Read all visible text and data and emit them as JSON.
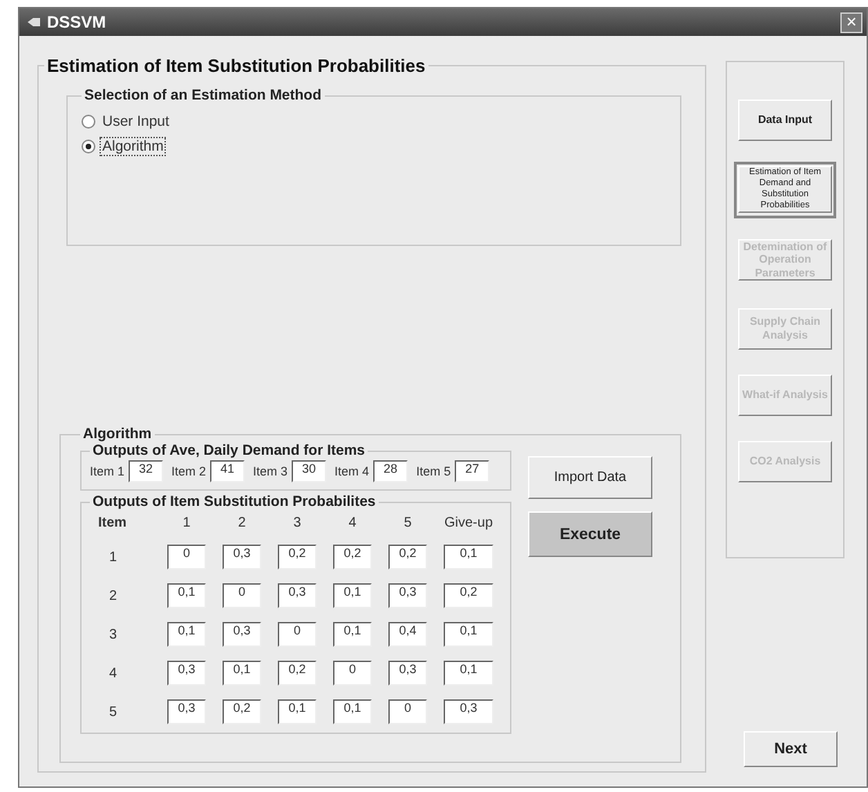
{
  "window": {
    "title": "DSSVM",
    "close": "×"
  },
  "main": {
    "title": "Estimation of Item Substitution Probabilities",
    "method": {
      "title": "Selection of an Estimation Method",
      "options": [
        {
          "label": "User Input",
          "selected": false,
          "focused": false
        },
        {
          "label": "Algorithm",
          "selected": true,
          "focused": true
        }
      ]
    },
    "algorithm": {
      "title": "Algorithm",
      "demand": {
        "title": "Outputs of Ave, Daily Demand for Items",
        "items": [
          {
            "label": "Item 1",
            "value": "32"
          },
          {
            "label": "Item 2",
            "value": "41"
          },
          {
            "label": "Item 3",
            "value": "30"
          },
          {
            "label": "Item 4",
            "value": "28"
          },
          {
            "label": "Item 5",
            "value": "27"
          }
        ]
      },
      "substitution": {
        "title": "Outputs of Item Substitution Probabilites",
        "columns": [
          "Item",
          "1",
          "2",
          "3",
          "4",
          "5",
          "Give-up"
        ],
        "rows": [
          {
            "item": "1",
            "values": [
              "0",
              "0,3",
              "0,2",
              "0,2",
              "0,2",
              "0,1"
            ]
          },
          {
            "item": "2",
            "values": [
              "0,1",
              "0",
              "0,3",
              "0,1",
              "0,3",
              "0,2"
            ]
          },
          {
            "item": "3",
            "values": [
              "0,1",
              "0,3",
              "0",
              "0,1",
              "0,4",
              "0,1"
            ]
          },
          {
            "item": "4",
            "values": [
              "0,3",
              "0,1",
              "0,2",
              "0",
              "0,3",
              "0,1"
            ]
          },
          {
            "item": "5",
            "values": [
              "0,3",
              "0,2",
              "0,1",
              "0,1",
              "0",
              "0,3"
            ]
          }
        ]
      },
      "buttons": [
        {
          "label": "Import Data",
          "pressed": false
        },
        {
          "label": "Execute",
          "pressed": true
        }
      ]
    }
  },
  "nav": {
    "items": [
      {
        "label": "Data Input",
        "selected": false,
        "disabled": false,
        "small": false
      },
      {
        "label": "Estimation of Item Demand and Substitution Probabilities",
        "selected": true,
        "disabled": false,
        "small": true
      },
      {
        "label": "Detemination of Operation Parameters",
        "selected": false,
        "disabled": true,
        "small": false
      },
      {
        "label": "Supply Chain Analysis",
        "selected": false,
        "disabled": true,
        "small": false
      },
      {
        "label": "What-if Analysis",
        "selected": false,
        "disabled": true,
        "small": false
      },
      {
        "label": "CO2 Analysis",
        "selected": false,
        "disabled": true,
        "small": false
      }
    ]
  },
  "next_button": {
    "label": "Next"
  }
}
